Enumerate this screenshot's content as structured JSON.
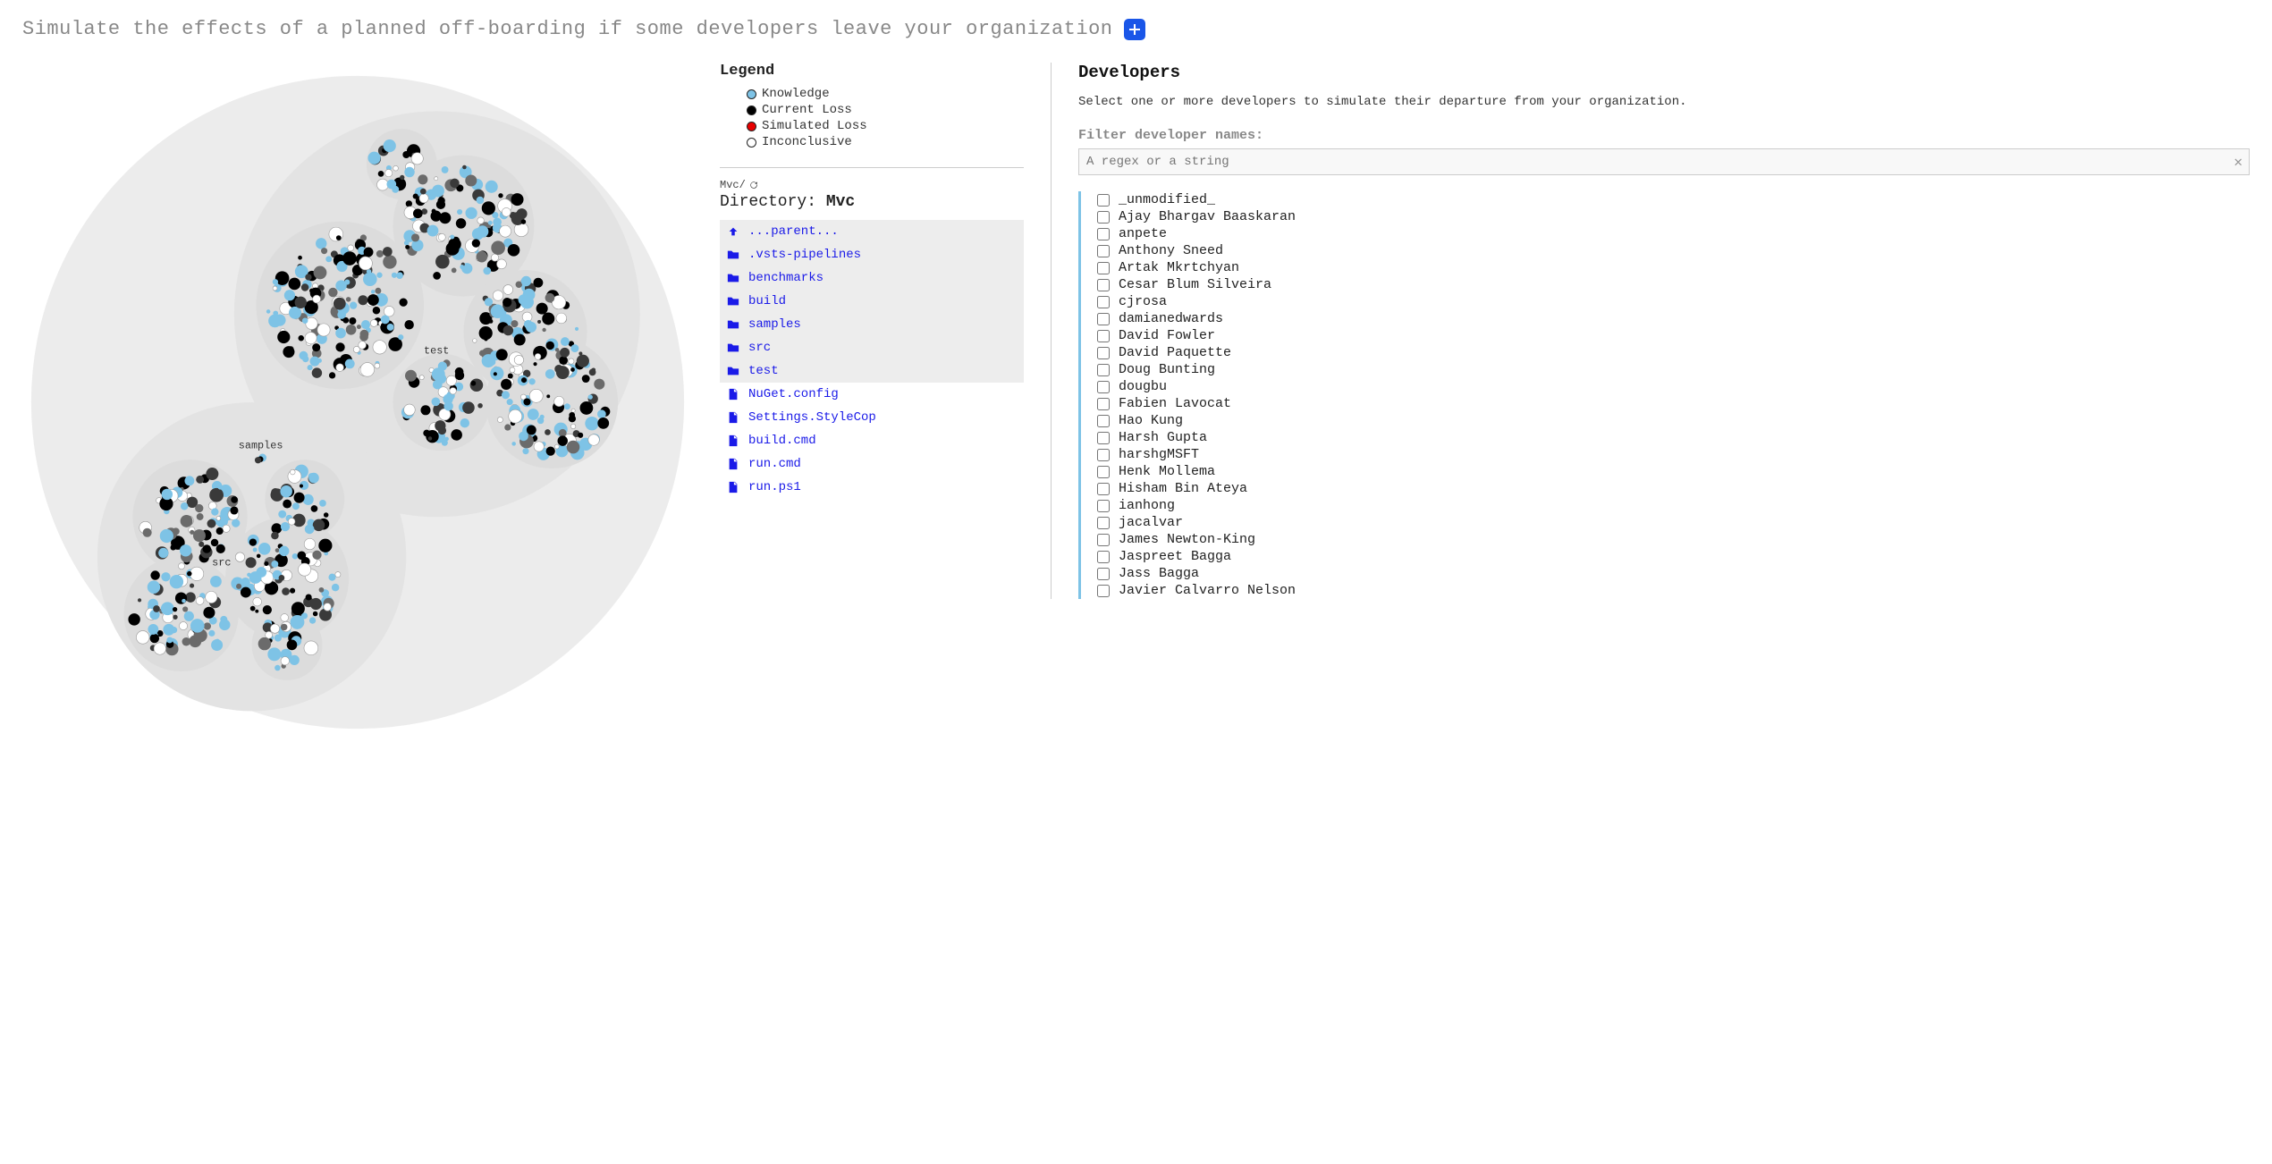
{
  "title": "Simulate the effects of a planned off-boarding if some developers leave your organization",
  "legend": {
    "heading": "Legend",
    "items": [
      {
        "key": "knowledge",
        "label": "Knowledge"
      },
      {
        "key": "current_loss",
        "label": "Current Loss"
      },
      {
        "key": "simulated_loss",
        "label": "Simulated Loss"
      },
      {
        "key": "inconclusive",
        "label": "Inconclusive"
      }
    ]
  },
  "breadcrumb": {
    "path": "Mvc/"
  },
  "directory": {
    "label": "Directory: ",
    "name": "Mvc",
    "entries": [
      {
        "type": "parent",
        "label": "...parent..."
      },
      {
        "type": "folder",
        "label": ".vsts-pipelines"
      },
      {
        "type": "folder",
        "label": "benchmarks"
      },
      {
        "type": "folder",
        "label": "build"
      },
      {
        "type": "folder",
        "label": "samples"
      },
      {
        "type": "folder",
        "label": "src"
      },
      {
        "type": "folder",
        "label": "test"
      },
      {
        "type": "file",
        "label": "NuGet.config"
      },
      {
        "type": "file",
        "label": "Settings.StyleCop"
      },
      {
        "type": "file",
        "label": "build.cmd"
      },
      {
        "type": "file",
        "label": "run.cmd"
      },
      {
        "type": "file",
        "label": "run.ps1"
      }
    ]
  },
  "developers": {
    "heading": "Developers",
    "description": "Select one or more developers to simulate their departure from your organization.",
    "filter_label": "Filter developer names:",
    "filter_placeholder": "A regex or a string",
    "list": [
      "_unmodified_",
      "Ajay Bhargav Baaskaran",
      "anpete",
      "Anthony Sneed",
      "Artak Mkrtchyan",
      "Cesar Blum Silveira",
      "cjrosa",
      "damianedwards",
      "David Fowler",
      "David Paquette",
      "Doug Bunting",
      "dougbu",
      "Fabien Lavocat",
      "Hao Kung",
      "Harsh Gupta",
      "harshgMSFT",
      "Henk Mollema",
      "Hisham Bin Ateya",
      "ianhong",
      "jacalvar",
      "James Newton-King",
      "Jaspreet Bagga",
      "Jass Bagga",
      "Javier Calvarro Nelson"
    ]
  },
  "viz": {
    "cluster_labels": {
      "samples": "samples",
      "src": "src",
      "test": "test"
    }
  },
  "colors": {
    "knowledge": "#7ec3e6",
    "current_loss": "#000000",
    "simulated_loss": "#e80000",
    "inconclusive": "#ffffff",
    "accent": "#1a56e8",
    "link": "#1a1ae8"
  }
}
